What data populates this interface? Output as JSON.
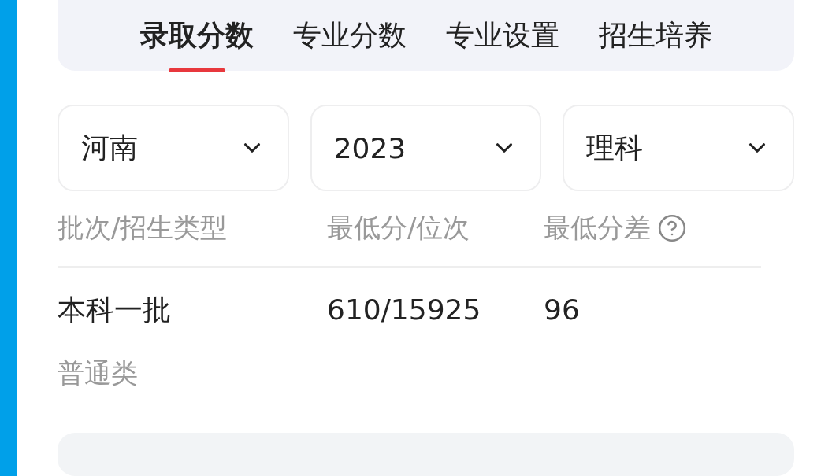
{
  "tabs": [
    {
      "label": "录取分数",
      "selected": true
    },
    {
      "label": "专业分数",
      "selected": false
    },
    {
      "label": "专业设置",
      "selected": false
    },
    {
      "label": "招生培养",
      "selected": false
    }
  ],
  "filters": [
    {
      "value": "河南"
    },
    {
      "value": "2023"
    },
    {
      "value": "理科"
    }
  ],
  "table": {
    "columns": [
      "批次/招生类型",
      "最低分/位次",
      "最低分差"
    ],
    "rows": [
      {
        "batch": "本科一批",
        "type": "普通类",
        "score_rank": "610/15925",
        "diff": "96"
      }
    ]
  }
}
